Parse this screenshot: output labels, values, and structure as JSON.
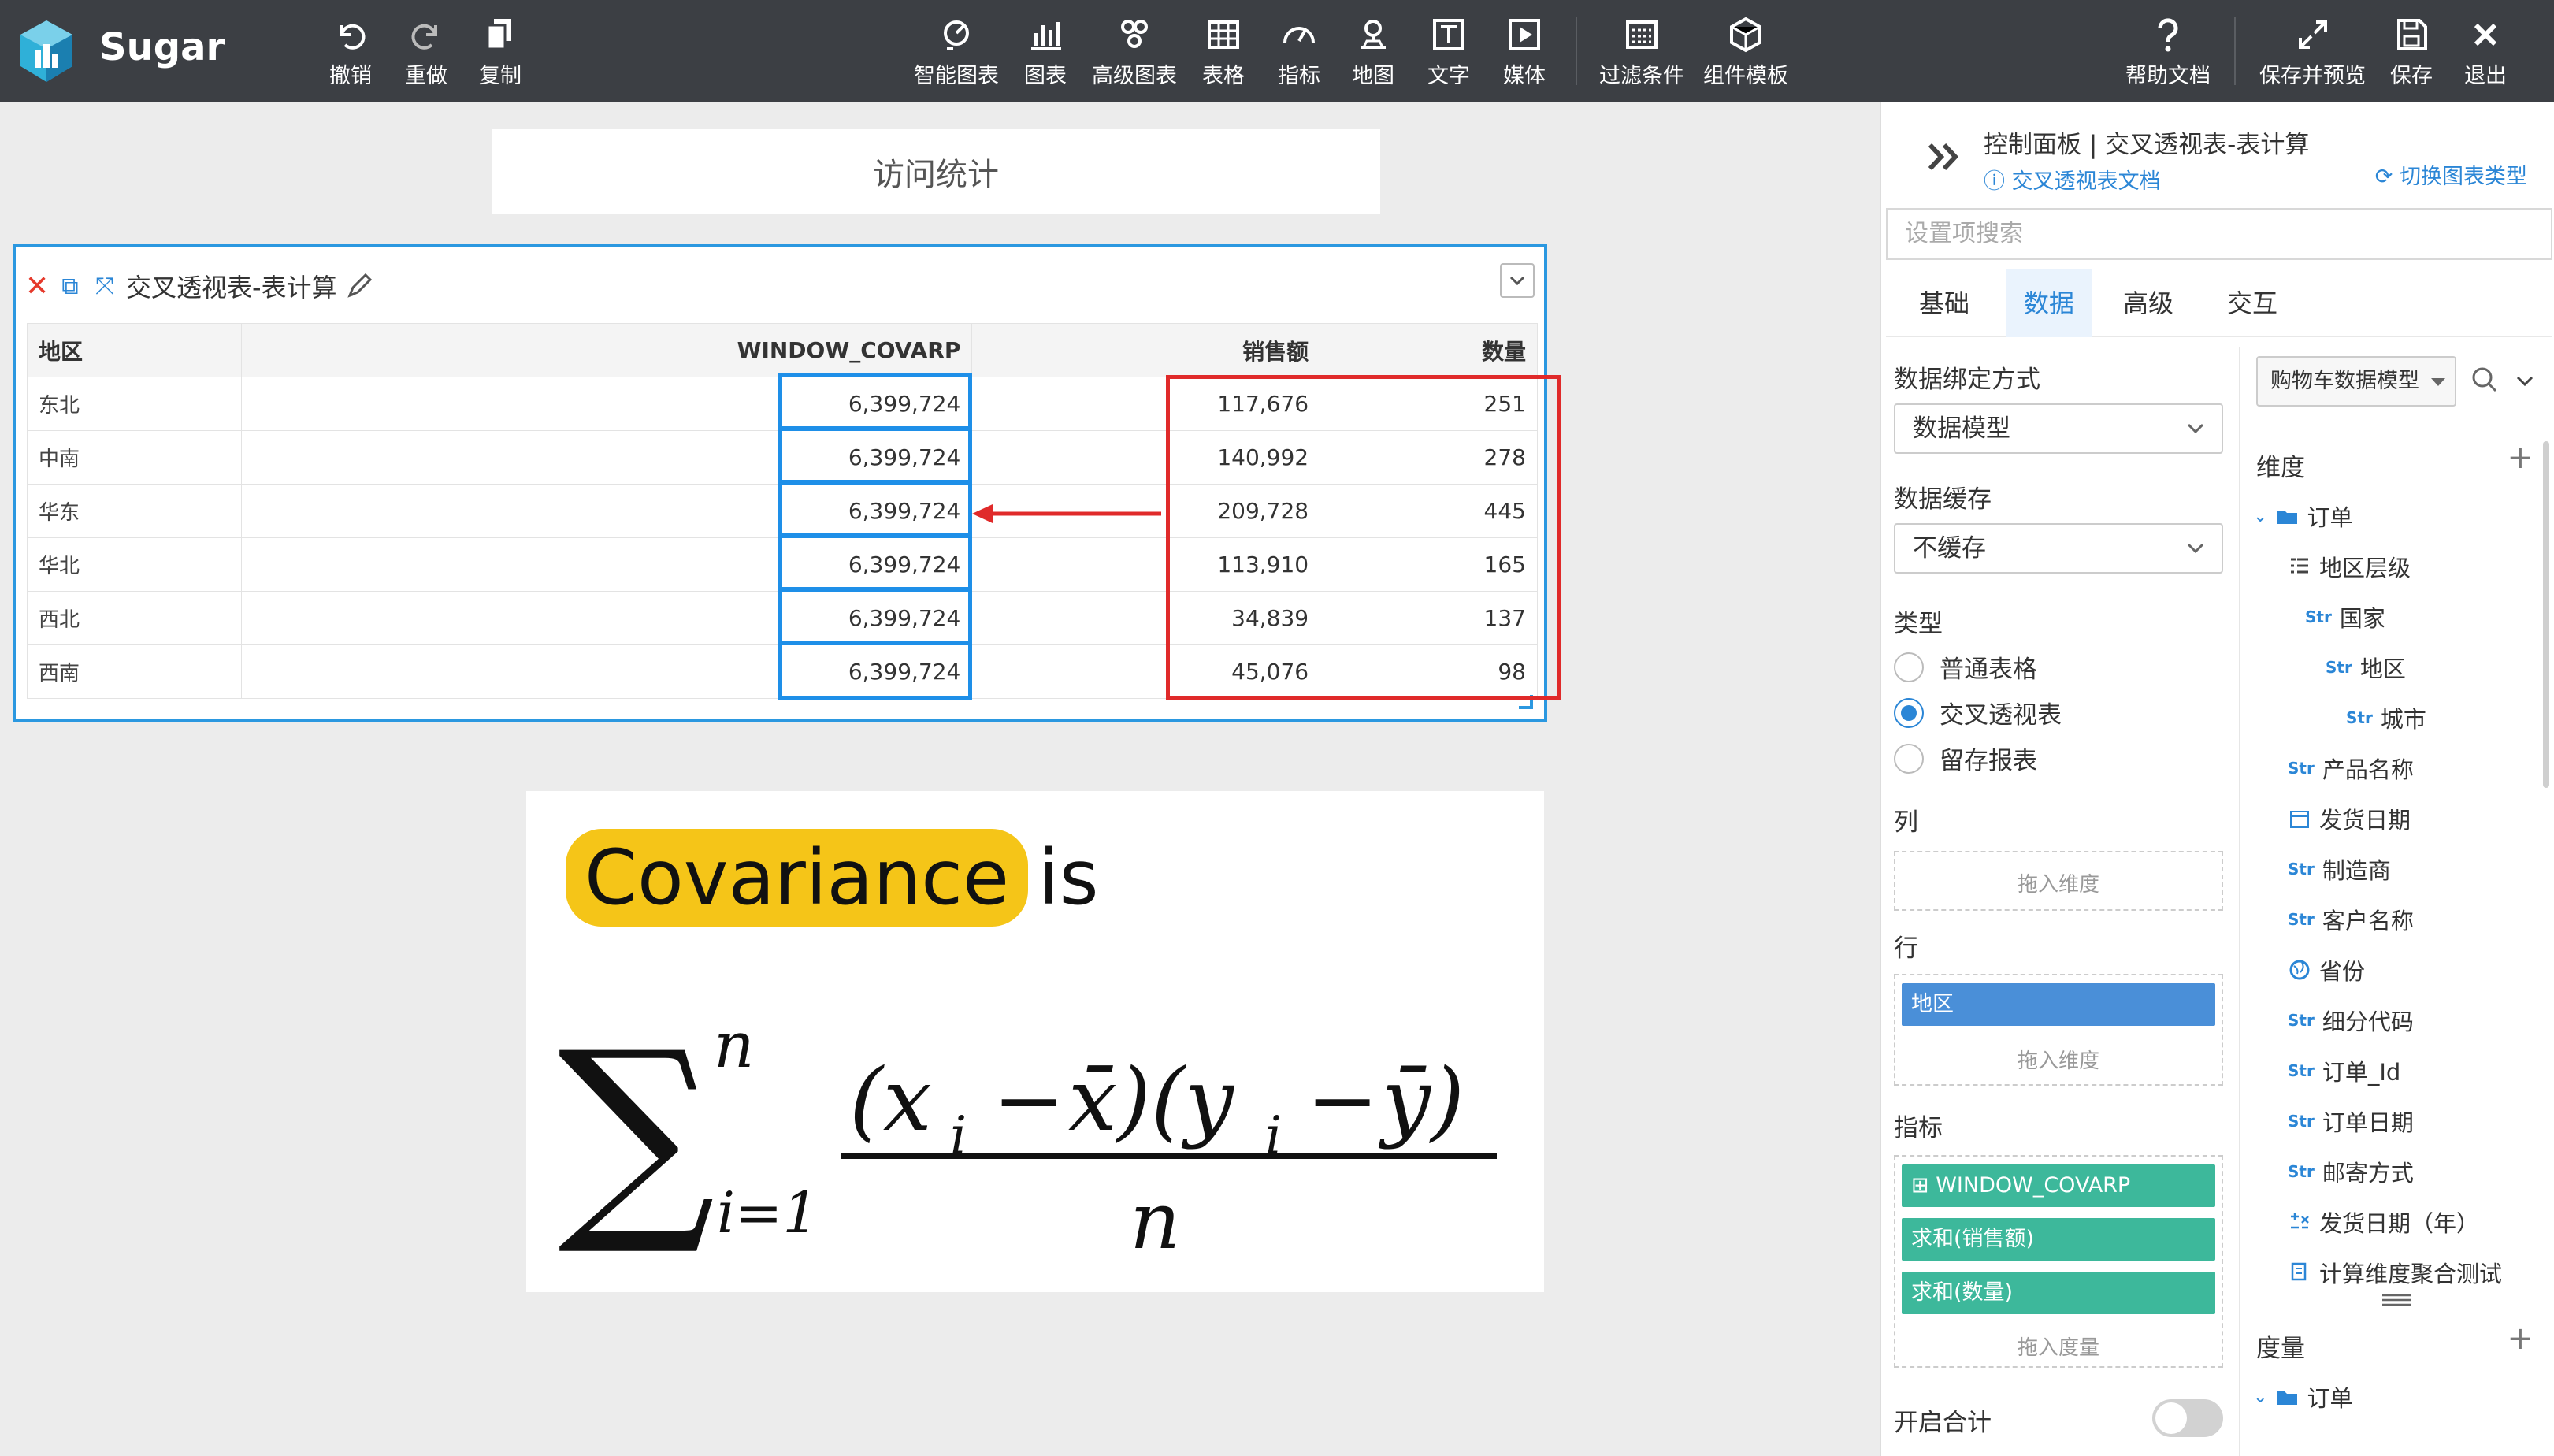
{
  "app": {
    "brand": "Sugar"
  },
  "toolbar": {
    "left": [
      {
        "label": "撤销",
        "icon": "undo-icon"
      },
      {
        "label": "重做",
        "icon": "redo-icon"
      },
      {
        "label": "复制",
        "icon": "copy-icon"
      }
    ],
    "center": [
      {
        "label": "智能图表",
        "icon": "smart-chart-icon"
      },
      {
        "label": "图表",
        "icon": "bar-chart-icon"
      },
      {
        "label": "高级图表",
        "icon": "advanced-chart-icon"
      },
      {
        "label": "表格",
        "icon": "table-icon"
      },
      {
        "label": "指标",
        "icon": "gauge-icon"
      },
      {
        "label": "地图",
        "icon": "map-pin-icon"
      },
      {
        "label": "文字",
        "icon": "text-icon"
      },
      {
        "label": "媒体",
        "icon": "media-icon"
      },
      {
        "label": "过滤条件",
        "icon": "filter-icon"
      },
      {
        "label": "组件模板",
        "icon": "template-icon"
      }
    ],
    "right": [
      {
        "label": "帮助文档",
        "icon": "help-icon"
      },
      {
        "label": "保存并预览",
        "icon": "expand-icon"
      },
      {
        "label": "保存",
        "icon": "save-icon"
      },
      {
        "label": "退出",
        "icon": "close-icon"
      }
    ]
  },
  "canvas": {
    "title_card": "访问统计",
    "widget": {
      "title": "交叉透视表-表计算",
      "columns": [
        "地区",
        "WINDOW_COVARP",
        "销售额",
        "数量"
      ],
      "rows": [
        {
          "region": "东北",
          "covarp": "6,399,724",
          "sales": "117,676",
          "qty": "251"
        },
        {
          "region": "中南",
          "covarp": "6,399,724",
          "sales": "140,992",
          "qty": "278"
        },
        {
          "region": "华东",
          "covarp": "6,399,724",
          "sales": "209,728",
          "qty": "445"
        },
        {
          "region": "华北",
          "covarp": "6,399,724",
          "sales": "113,910",
          "qty": "165"
        },
        {
          "region": "西北",
          "covarp": "6,399,724",
          "sales": "34,839",
          "qty": "137"
        },
        {
          "region": "西南",
          "covarp": "6,399,724",
          "sales": "45,076",
          "qty": "98"
        }
      ]
    },
    "formula": {
      "word": "Covariance",
      "suffix": "is"
    }
  },
  "panel": {
    "title": "控制面板 | 交叉透视表-表计算",
    "doc_link": "交叉透视表文档",
    "switch_link": "切换图表类型",
    "search_placeholder": "设置项搜索",
    "tabs": [
      "基础",
      "数据",
      "高级",
      "交互"
    ],
    "active_tab": "数据",
    "binding_label": "数据绑定方式",
    "binding_value": "数据模型",
    "cache_label": "数据缓存",
    "cache_value": "不缓存",
    "type_label": "类型",
    "types": [
      "普通表格",
      "交叉透视表",
      "留存报表"
    ],
    "selected_type": "交叉透视表",
    "col_label": "列",
    "col_hint": "拖入维度",
    "row_label": "行",
    "row_chip": "地区",
    "row_hint": "拖入维度",
    "metric_label": "指标",
    "metric_chips": [
      "WINDOW_COVARP",
      "求和(销售额)",
      "求和(数量)"
    ],
    "metric_hint": "拖入度量",
    "total_label": "开启合计",
    "model": "购物车数据模型",
    "dim_label": "维度",
    "measure_label": "度量",
    "tree": [
      {
        "label": "订单",
        "kind": "folder"
      },
      {
        "label": "地区层级",
        "kind": "hierarchy"
      },
      {
        "label": "国家",
        "kind": "str"
      },
      {
        "label": "地区",
        "kind": "str"
      },
      {
        "label": "城市",
        "kind": "str"
      },
      {
        "label": "产品名称",
        "kind": "str"
      },
      {
        "label": "发货日期",
        "kind": "date"
      },
      {
        "label": "制造商",
        "kind": "str"
      },
      {
        "label": "客户名称",
        "kind": "str"
      },
      {
        "label": "省份",
        "kind": "geo"
      },
      {
        "label": "细分代码",
        "kind": "str"
      },
      {
        "label": "订单_Id",
        "kind": "str"
      },
      {
        "label": "订单日期",
        "kind": "str"
      },
      {
        "label": "邮寄方式",
        "kind": "str"
      },
      {
        "label": "发货日期（年）",
        "kind": "calc"
      },
      {
        "label": "计算维度聚合测试",
        "kind": "calc2"
      }
    ],
    "measure_folder": "订单",
    "str_tag": "Str"
  }
}
